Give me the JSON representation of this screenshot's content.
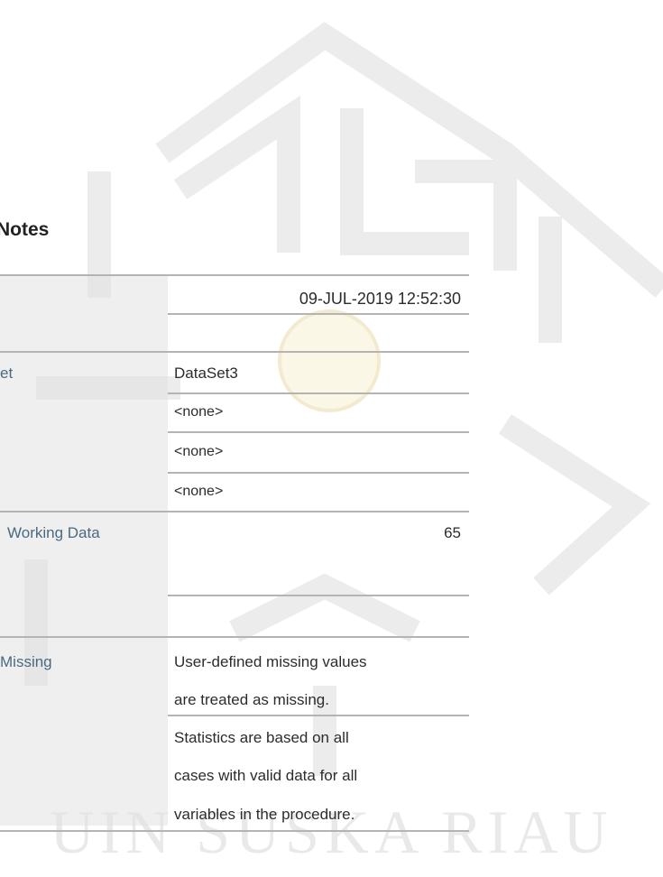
{
  "title": "Notes",
  "output_created": "09-JUL-2019 12:52:30",
  "rows": {
    "active_dataset": {
      "label": "et",
      "value": "DataSet3"
    },
    "filter": {
      "value": "<none>"
    },
    "weight": {
      "value": "<none>"
    },
    "split_file": {
      "value": "<none>"
    },
    "n_rows": {
      "label": "Working Data",
      "value": "65"
    },
    "missing_definition": {
      "label": "Missing",
      "value_line1": "User-defined missing values",
      "value_line2": "are treated as missing."
    },
    "cases_used": {
      "line1": "Statistics are based on all",
      "line2": "cases with valid data for all",
      "line3": "variables in the procedure."
    }
  },
  "watermark": {
    "text": "UIN SUSKA RIAU",
    "color": "#e9e9e9"
  }
}
